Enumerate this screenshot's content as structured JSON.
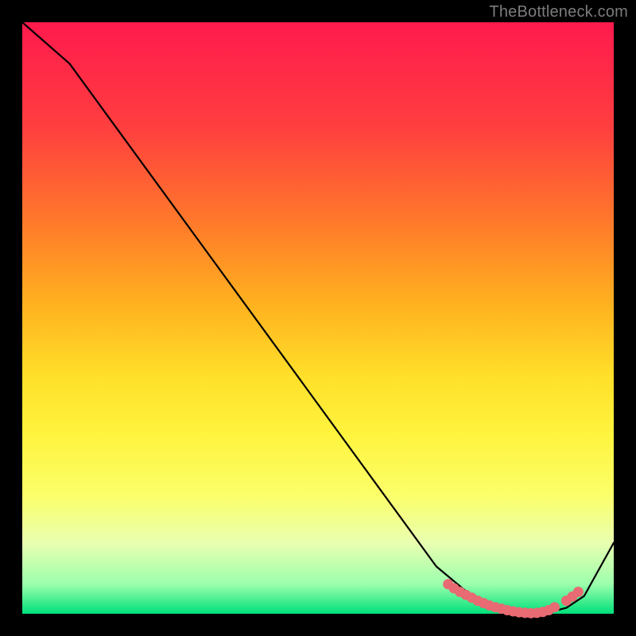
{
  "watermark": "TheBottleneck.com",
  "chart_data": {
    "type": "line",
    "title": "",
    "xlabel": "",
    "ylabel": "",
    "xlim": [
      0,
      100
    ],
    "ylim": [
      0,
      100
    ],
    "series": [
      {
        "name": "curve",
        "x": [
          0,
          8,
          70,
          76,
          80,
          84,
          88,
          92,
          95,
          100
        ],
        "y": [
          100,
          93,
          8,
          3,
          1,
          0,
          0,
          1,
          3,
          12
        ]
      }
    ],
    "markers": {
      "name": "highlight-dots",
      "color": "#e86a72",
      "x": [
        72,
        73,
        74,
        75,
        76,
        77,
        78,
        79,
        80,
        81,
        82,
        83,
        84,
        85,
        86,
        87,
        88,
        89,
        90,
        92,
        93,
        94
      ],
      "y": [
        5,
        4.3,
        3.7,
        3.2,
        2.7,
        2.2,
        1.8,
        1.4,
        1.1,
        0.85,
        0.6,
        0.4,
        0.25,
        0.15,
        0.1,
        0.15,
        0.3,
        0.6,
        1.1,
        2.2,
        2.9,
        3.7
      ]
    }
  }
}
